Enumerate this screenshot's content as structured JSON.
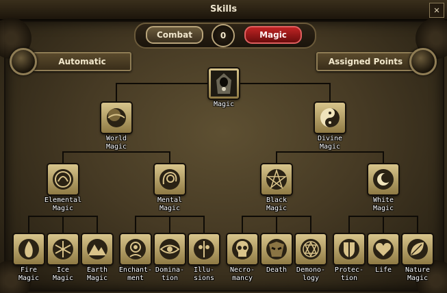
{
  "window": {
    "title": "Skills"
  },
  "tabs": {
    "combat": "Combat",
    "magic": "Magic",
    "points": "0"
  },
  "panels": {
    "left": "Automatic",
    "right": "Assigned Points"
  },
  "tree": {
    "magic": {
      "l1": "Magic",
      "l2": ""
    },
    "world": {
      "l1": "World",
      "l2": "Magic"
    },
    "divine": {
      "l1": "Divine",
      "l2": "Magic"
    },
    "elemental": {
      "l1": "Elemental",
      "l2": "Magic"
    },
    "mental": {
      "l1": "Mental",
      "l2": "Magic"
    },
    "black": {
      "l1": "Black",
      "l2": "Magic"
    },
    "white": {
      "l1": "White",
      "l2": "Magic"
    },
    "fire": {
      "l1": "Fire",
      "l2": "Magic"
    },
    "ice": {
      "l1": "Ice",
      "l2": "Magic"
    },
    "earth": {
      "l1": "Earth",
      "l2": "Magic"
    },
    "enchantment": {
      "l1": "Enchant-",
      "l2": "ment"
    },
    "domination": {
      "l1": "Domina-",
      "l2": "tion"
    },
    "illusions": {
      "l1": "Illu-",
      "l2": "sions"
    },
    "necromancy": {
      "l1": "Necro-",
      "l2": "mancy"
    },
    "death": {
      "l1": "Death",
      "l2": ""
    },
    "demonology": {
      "l1": "Demono-",
      "l2": "logy"
    },
    "protection": {
      "l1": "Protec-",
      "l2": "tion"
    },
    "life": {
      "l1": "Life",
      "l2": ""
    },
    "nature": {
      "l1": "Nature",
      "l2": "Magic"
    }
  },
  "icons": {
    "magic": "hooded-mage-icon",
    "world": "sphere-icon",
    "divine": "yin-yang-icon",
    "elemental": "elements-icon",
    "mental": "mind-icon",
    "black": "pentagram-icon",
    "white": "sun-moon-icon",
    "fire": "flame-icon",
    "ice": "snowflake-icon",
    "earth": "mountain-icon",
    "enchantment": "spiral-head-icon",
    "domination": "eye-icon",
    "illusions": "mask-icon",
    "necromancy": "skull-icon",
    "death": "reaper-mask-icon",
    "demonology": "demon-sigil-icon",
    "protection": "shield-icon",
    "life": "heart-icon",
    "nature": "leaf-icon"
  },
  "colors": {
    "active_tab": "#b01c1c",
    "icon_gold": "#cdb97c",
    "frame": "#8f7d55"
  }
}
